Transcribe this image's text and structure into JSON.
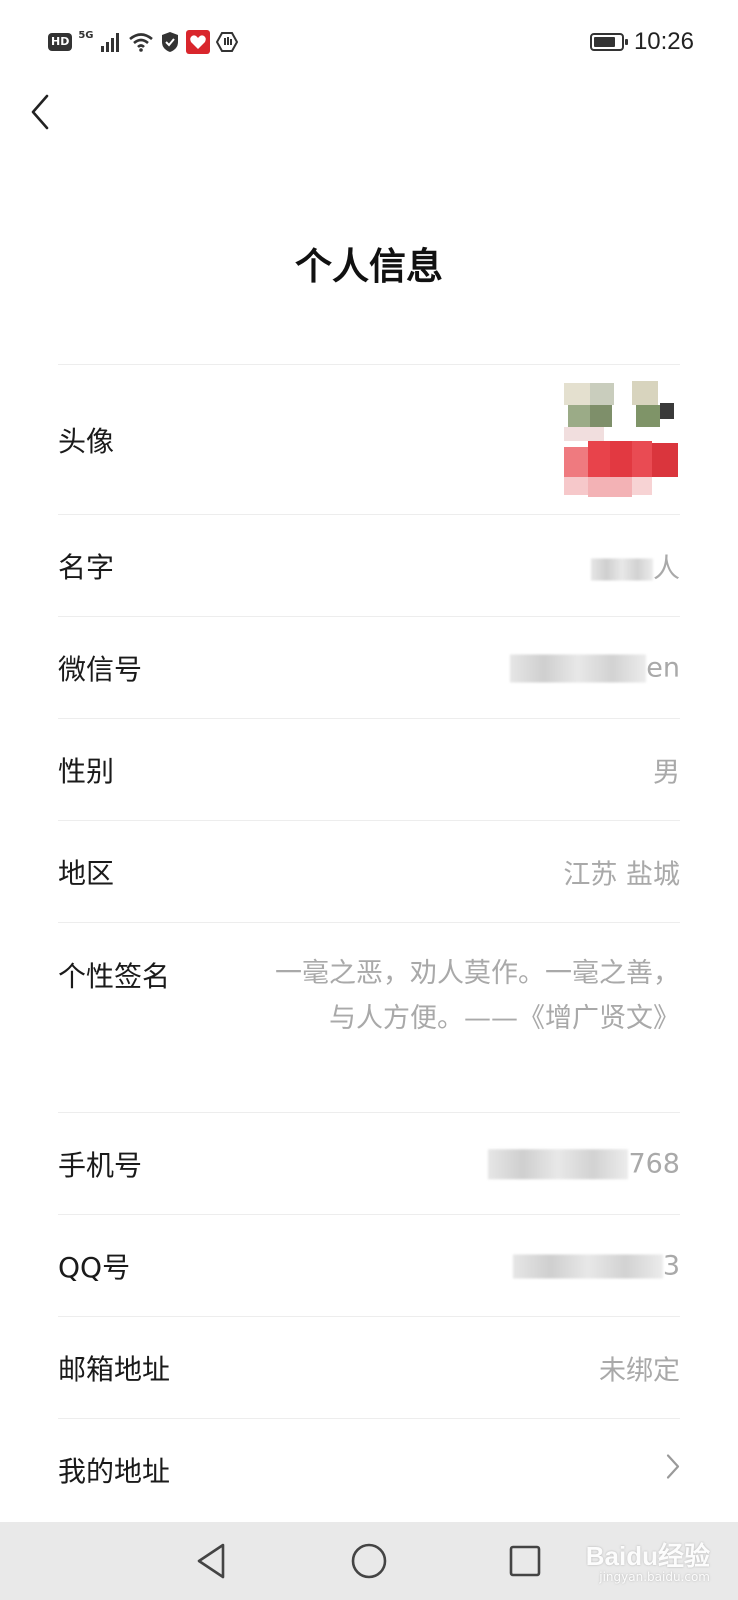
{
  "status_bar": {
    "hd_label": "HD",
    "network_label": "5G",
    "time": "10:26",
    "battery_level": 0.85
  },
  "page": {
    "title": "个人信息"
  },
  "rows": {
    "avatar": {
      "label": "头像"
    },
    "name": {
      "label": "名字",
      "value_suffix": "人"
    },
    "wechat_id": {
      "label": "微信号",
      "value_suffix": "en"
    },
    "gender": {
      "label": "性别",
      "value": "男"
    },
    "region": {
      "label": "地区",
      "value": "江苏 盐城"
    },
    "signature": {
      "label": "个性签名",
      "value": "一毫之恶，劝人莫作。一毫之善，与人方便。——《增广贤文》"
    },
    "phone": {
      "label": "手机号",
      "value_suffix": "768"
    },
    "qq": {
      "label": "QQ号",
      "value_suffix": "3"
    },
    "email": {
      "label": "邮箱地址",
      "value": "未绑定"
    },
    "my_address": {
      "label": "我的地址"
    }
  },
  "watermark": {
    "text": "Baidu经验",
    "sub": "jingyan.baidu.com"
  }
}
